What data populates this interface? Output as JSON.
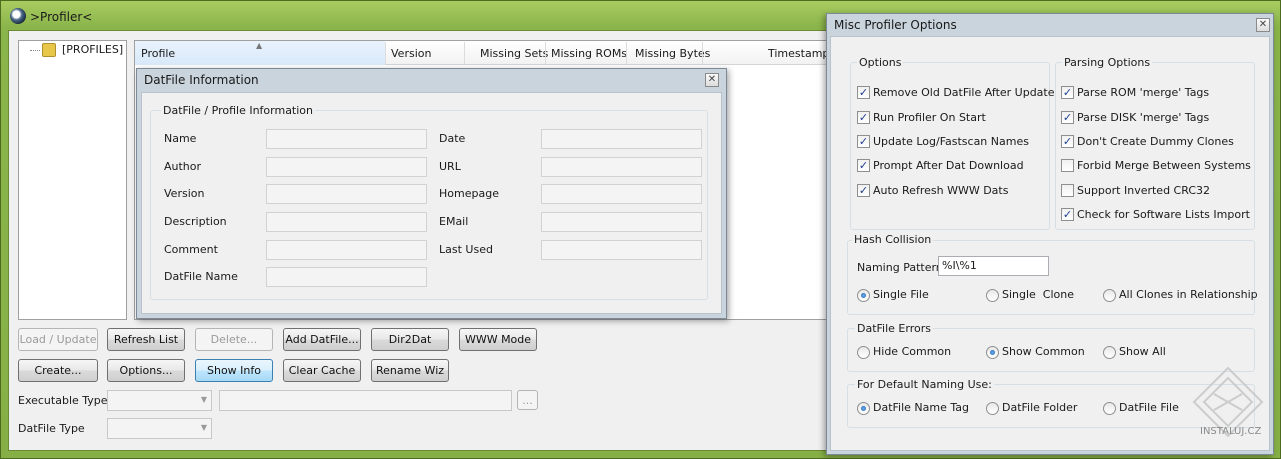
{
  "main_window": {
    "title": ">Profiler<",
    "tree": {
      "root_label": "[PROFILES]"
    },
    "list_columns": [
      "Profile",
      "Version",
      "Missing Sets",
      "Missing ROMs",
      "Missing Bytes",
      "Timestamp"
    ],
    "buttons_row1": [
      "Load / Update",
      "Refresh List",
      "Delete...",
      "Add DatFile...",
      "Dir2Dat",
      "WWW Mode"
    ],
    "buttons_row2": [
      "Create...",
      "Options...",
      "Show Info",
      "Clear Cache",
      "Rename Wiz"
    ],
    "executable_type_label": "Executable Type",
    "datfile_type_label": "DatFile Type",
    "browse_button": "..."
  },
  "datfile_info": {
    "title": "DatFile Information",
    "group_label": "DatFile / Profile Information",
    "fields_left": [
      "Name",
      "Author",
      "Version",
      "Description",
      "Comment",
      "DatFile Name"
    ],
    "fields_right": [
      "Date",
      "URL",
      "Homepage",
      "EMail",
      "Last Used"
    ]
  },
  "misc_options": {
    "title": "Misc Profiler Options",
    "options_group": {
      "label": "Options",
      "items": [
        {
          "label": "Remove Old DatFile After Update",
          "checked": true
        },
        {
          "label": "Run Profiler On Start",
          "checked": true
        },
        {
          "label": "Update Log/Fastscan Names",
          "checked": true
        },
        {
          "label": "Prompt After Dat Download",
          "checked": true
        },
        {
          "label": "Auto Refresh WWW Dats",
          "checked": true
        }
      ]
    },
    "parsing_group": {
      "label": "Parsing Options",
      "items": [
        {
          "label": "Parse ROM 'merge' Tags",
          "checked": true
        },
        {
          "label": "Parse DISK 'merge' Tags",
          "checked": true
        },
        {
          "label": "Don't Create Dummy Clones",
          "checked": true
        },
        {
          "label": "Forbid Merge Between Systems",
          "checked": false
        },
        {
          "label": "Support Inverted CRC32",
          "checked": false
        },
        {
          "label": "Check for Software Lists Import",
          "checked": true
        }
      ]
    },
    "hash_collision": {
      "label": "Hash Collision",
      "naming_pattern_label": "Naming Pattern",
      "naming_pattern_value": "%I\\%1",
      "radios": [
        {
          "label": "Single File",
          "selected": true
        },
        {
          "label": "Single  Clone",
          "selected": false
        },
        {
          "label": "All Clones in Relationship",
          "selected": false
        }
      ]
    },
    "datfile_errors": {
      "label": "DatFile Errors",
      "radios": [
        {
          "label": "Hide Common",
          "selected": false
        },
        {
          "label": "Show Common",
          "selected": true
        },
        {
          "label": "Show All",
          "selected": false
        }
      ]
    },
    "default_naming": {
      "label": "For Default Naming Use:",
      "radios": [
        {
          "label": "DatFile Name Tag",
          "selected": true
        },
        {
          "label": "DatFile Folder",
          "selected": false
        },
        {
          "label": "DatFile File",
          "selected": false
        }
      ]
    }
  },
  "watermark": {
    "text": "INSTALUJ.CZ"
  },
  "colors": {
    "frame_green": "#86b046",
    "dialog_bg": "#f0f0f0",
    "focus_blue": "#3c7fb1"
  },
  "icons": [
    "app-magnifier-icon",
    "folder-icon",
    "close-icon",
    "checkmark-icon",
    "chevron-down-icon",
    "sort-up-icon"
  ]
}
